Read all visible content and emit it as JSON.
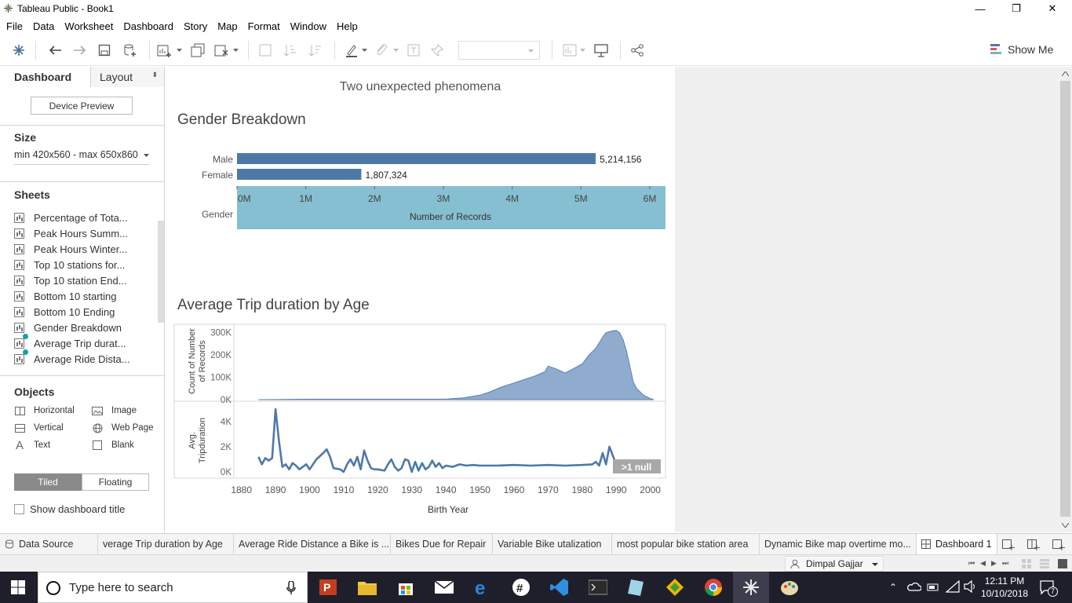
{
  "window": {
    "title": "Tableau Public - Book1",
    "minimize": "—",
    "restore": "❐",
    "close": "✕"
  },
  "menu": [
    "File",
    "Data",
    "Worksheet",
    "Dashboard",
    "Story",
    "Map",
    "Format",
    "Window",
    "Help"
  ],
  "toolbar": {
    "show_me": "Show Me"
  },
  "left_panel": {
    "tab_dashboard": "Dashboard",
    "tab_layout": "Layout",
    "device_preview": "Device Preview",
    "size_heading": "Size",
    "size_value": "min 420x560 - max 650x860",
    "sheets_heading": "Sheets",
    "sheets": [
      "Percentage of Tota...",
      "Peak Hours Summ...",
      "Peak Hours Winter...",
      "Top 10 stations for...",
      "Top 10 station End...",
      "Bottom 10 starting",
      "Bottom 10 Ending",
      "Gender Breakdown",
      "Average Trip durat...",
      "Average Ride Dista..."
    ],
    "objects_heading": "Objects",
    "objects": {
      "horizontal": "Horizontal",
      "image": "Image",
      "vertical": "Vertical",
      "web_page": "Web Page",
      "text": "Text",
      "blank": "Blank"
    },
    "tiled": "Tiled",
    "floating": "Floating",
    "show_title": "Show dashboard title"
  },
  "dashboard": {
    "title": "Two unexpected phenomena",
    "gender_title": "Gender Breakdown",
    "age_title": "Average Trip duration by Age"
  },
  "chart_data": [
    {
      "type": "bar",
      "title": "Gender Breakdown",
      "ylabel": "Gender",
      "xlabel": "Number of Records",
      "categories": [
        "Male",
        "Female"
      ],
      "values": [
        5214156,
        1807324
      ],
      "value_labels": [
        "5,214,156",
        "1,807,324"
      ],
      "xticks": [
        "0M",
        "1M",
        "2M",
        "3M",
        "4M",
        "5M",
        "6M"
      ],
      "xlim": [
        0,
        6000000
      ],
      "color": "#4e79a7",
      "axis_band_color": "#86bfd1"
    },
    {
      "type": "area",
      "title": "Average Trip duration by Age",
      "ylabel": "Count of Number of Records",
      "xlabel": "Birth Year",
      "yticks": [
        "300K",
        "200K",
        "100K",
        "0K"
      ],
      "ylim": [
        0,
        320000
      ],
      "xlim": [
        1878,
        2004
      ],
      "xticks": [
        "1880",
        "1890",
        "1900",
        "1910",
        "1920",
        "1930",
        "1940",
        "1950",
        "1960",
        "1970",
        "1980",
        "1990",
        "2000"
      ],
      "color": "#7b9cc4",
      "x": [
        1885,
        1900,
        1940,
        1945,
        1950,
        1953,
        1956,
        1960,
        1963,
        1966,
        1969,
        1970,
        1972,
        1975,
        1977,
        1980,
        1982,
        1984,
        1986,
        1987,
        1988,
        1989,
        1990,
        1991,
        1992,
        1993,
        1994,
        1995,
        1996,
        1997,
        1998,
        2000,
        2001
      ],
      "y": [
        0,
        2000,
        2000,
        8000,
        20000,
        35000,
        55000,
        75000,
        90000,
        105000,
        125000,
        150000,
        140000,
        120000,
        135000,
        160000,
        200000,
        230000,
        280000,
        300000,
        305000,
        308000,
        310000,
        300000,
        270000,
        220000,
        150000,
        80000,
        50000,
        35000,
        20000,
        5000,
        0
      ]
    },
    {
      "type": "line",
      "title": "Average Trip duration by Age",
      "ylabel": "Avg. Tripduration",
      "xlabel": "Birth Year",
      "yticks": [
        "4K",
        "2K",
        "0K"
      ],
      "ylim": [
        0,
        5500
      ],
      "xlim": [
        1878,
        2004
      ],
      "color": "#4e79a7",
      "null_badge": ">1 null",
      "x": [
        1885,
        1886,
        1887,
        1888,
        1889,
        1890,
        1891,
        1892,
        1893,
        1894,
        1895,
        1896,
        1897,
        1898,
        1899,
        1900,
        1902,
        1904,
        1905,
        1906,
        1907,
        1909,
        1910,
        1911,
        1912,
        1913,
        1914,
        1915,
        1916,
        1917,
        1918,
        1919,
        1920,
        1922,
        1923,
        1924,
        1925,
        1926,
        1927,
        1928,
        1929,
        1930,
        1931,
        1932,
        1933,
        1934,
        1935,
        1936,
        1937,
        1938,
        1939,
        1940,
        1942,
        1944,
        1946,
        1948,
        1950,
        1955,
        1960,
        1965,
        1970,
        1975,
        1980,
        1983,
        1984,
        1985,
        1986,
        1987,
        1988,
        1990,
        1992,
        1995,
        1998
      ],
      "y": [
        1200,
        600,
        1100,
        900,
        1100,
        5000,
        2500,
        400,
        600,
        200,
        700,
        500,
        200,
        400,
        600,
        200,
        1000,
        1500,
        1800,
        1200,
        300,
        200,
        0,
        600,
        1000,
        500,
        1200,
        200,
        1700,
        900,
        300,
        200,
        200,
        100,
        600,
        1000,
        400,
        100,
        300,
        1000,
        900,
        0,
        800,
        100,
        700,
        200,
        400,
        900,
        400,
        700,
        300,
        500,
        400,
        600,
        500,
        550,
        500,
        500,
        550,
        500,
        550,
        500,
        550,
        600,
        800,
        500,
        1500,
        600,
        2000,
        600,
        600,
        550,
        500
      ]
    }
  ],
  "bottom_tabs": [
    "Data Source",
    "verage Trip duration by Age",
    "Average Ride Distance a Bike is ...",
    "Bikes Due for Repair",
    "Variable Bike utalization",
    "most popular bike station area",
    "Dynamic Bike map overtime mo...",
    "Dashboard 1"
  ],
  "status": {
    "user": "Dimpal Gajjar"
  },
  "taskbar": {
    "search_placeholder": "Type here to search",
    "time": "12:11 PM",
    "date": "10/10/2018",
    "notif_count": "7"
  },
  "colors": {
    "taskbar": "#1f1f2b",
    "accent": "#4e79a7",
    "teal": "#1a9fa0"
  }
}
